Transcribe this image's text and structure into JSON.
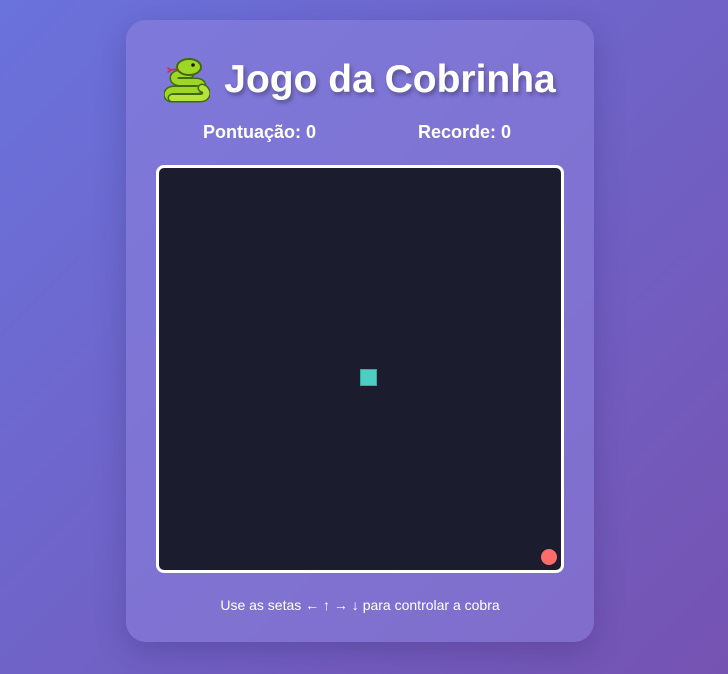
{
  "header": {
    "icon": "snake-icon",
    "title": "Jogo da Cobrinha"
  },
  "scores": {
    "score_label": "Pontuação: 0",
    "score_value": 0,
    "record_label": "Recorde: 0",
    "record_value": 0
  },
  "board": {
    "background_color": "#1b1c2e",
    "snake_color": "#4ecdc4",
    "food_color": "#ff6b6b"
  },
  "instructions": "Use as setas ← ↑ → ↓ para controlar a cobra"
}
